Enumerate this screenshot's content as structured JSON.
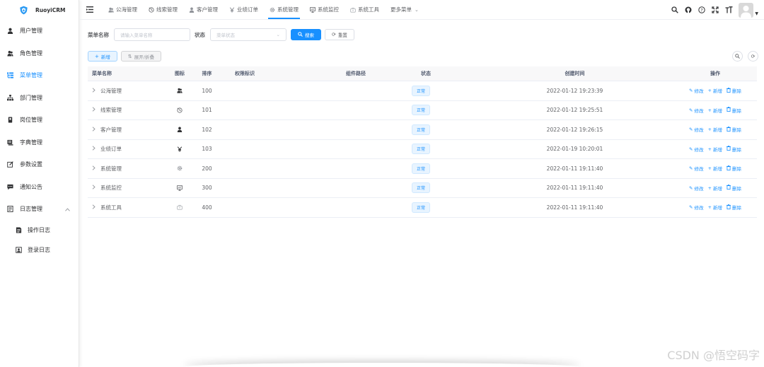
{
  "app": {
    "title": "RuoyiCRM",
    "brand_color": "#1890ff"
  },
  "sidebar": {
    "items": [
      {
        "label": "用户管理",
        "icon": "user-icon"
      },
      {
        "label": "角色管理",
        "icon": "peoples-icon"
      },
      {
        "label": "菜单管理",
        "icon": "tree-table-icon",
        "active": true
      },
      {
        "label": "部门管理",
        "icon": "tree-icon"
      },
      {
        "label": "岗位管理",
        "icon": "post-icon"
      },
      {
        "label": "字典管理",
        "icon": "dict-icon"
      },
      {
        "label": "参数设置",
        "icon": "edit-icon"
      },
      {
        "label": "通知公告",
        "icon": "message-icon"
      },
      {
        "label": "日志管理",
        "icon": "log-icon",
        "expanded": true
      }
    ],
    "subitems": [
      {
        "label": "操作日志",
        "icon": "form-icon"
      },
      {
        "label": "登录日志",
        "icon": "logininfor-icon"
      }
    ]
  },
  "topnav": {
    "items": [
      {
        "label": "公海管理",
        "icon": "peoples-icon"
      },
      {
        "label": "线索管理",
        "icon": "clue-icon"
      },
      {
        "label": "客户管理",
        "icon": "user-icon"
      },
      {
        "label": "业绩订单",
        "icon": "yen-icon"
      },
      {
        "label": "系统管理",
        "icon": "gear-icon",
        "active": true
      },
      {
        "label": "系统监控",
        "icon": "monitor-icon"
      },
      {
        "label": "系统工具",
        "icon": "tool-icon"
      },
      {
        "label": "更多菜单",
        "icon": "chevron-down-icon"
      }
    ],
    "right_tools": [
      "search-icon",
      "github-icon",
      "question-icon",
      "fullscreen-icon",
      "font-size-icon"
    ]
  },
  "search": {
    "name_label": "菜单名称",
    "name_placeholder": "请输入菜单名称",
    "status_label": "状态",
    "status_placeholder": "菜单状态",
    "search_button": "搜索",
    "reset_button": "重置"
  },
  "toolbar": {
    "add_button": "新增",
    "expand_button": "展开/折叠"
  },
  "table": {
    "headers": {
      "name": "菜单名称",
      "icon": "图标",
      "order": "排序",
      "perms": "权限标识",
      "component": "组件路径",
      "status": "状态",
      "created": "创建时间",
      "ops": "操作"
    },
    "op_labels": {
      "edit": "修改",
      "add": "新增",
      "delete": "删除"
    },
    "rows": [
      {
        "name": "公海管理",
        "icon": "peoples-icon",
        "order": "100",
        "perms": "",
        "component": "",
        "status": "正常",
        "created": "2022-01-12 19:23:39"
      },
      {
        "name": "线索管理",
        "icon": "clue-icon",
        "order": "101",
        "perms": "",
        "component": "",
        "status": "正常",
        "created": "2022-01-12 19:25:51"
      },
      {
        "name": "客户管理",
        "icon": "user-icon",
        "order": "102",
        "perms": "",
        "component": "",
        "status": "正常",
        "created": "2022-01-12 19:26:15"
      },
      {
        "name": "业绩订单",
        "icon": "yen-icon",
        "order": "103",
        "perms": "",
        "component": "",
        "status": "正常",
        "created": "2022-01-19 10:20:01"
      },
      {
        "name": "系统管理",
        "icon": "gear-icon",
        "order": "200",
        "perms": "",
        "component": "",
        "status": "正常",
        "created": "2022-01-11 19:11:40"
      },
      {
        "name": "系统监控",
        "icon": "monitor-icon",
        "order": "300",
        "perms": "",
        "component": "",
        "status": "正常",
        "created": "2022-01-11 19:11:40"
      },
      {
        "name": "系统工具",
        "icon": "tool-icon",
        "order": "400",
        "perms": "",
        "component": "",
        "status": "正常",
        "created": "2022-01-11 19:11:40"
      }
    ]
  },
  "watermark": "CSDN @悟空码字"
}
